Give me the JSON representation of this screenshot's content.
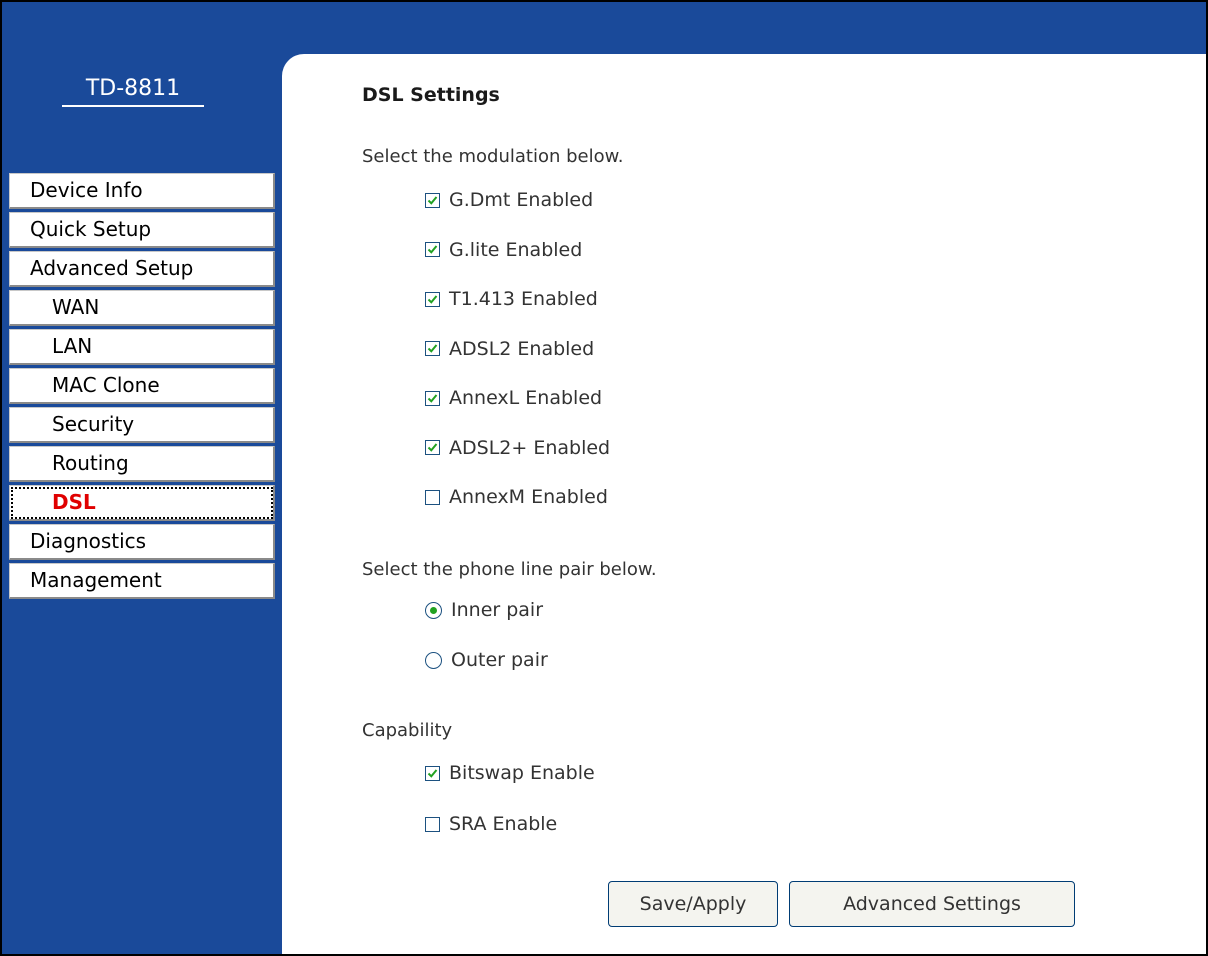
{
  "brand": {
    "model": "TD-8811"
  },
  "nav": [
    {
      "label": "Device Info",
      "level": 0,
      "active": false,
      "name": "nav-device-info"
    },
    {
      "label": "Quick Setup",
      "level": 0,
      "active": false,
      "name": "nav-quick-setup"
    },
    {
      "label": "Advanced Setup",
      "level": 0,
      "active": false,
      "name": "nav-advanced-setup"
    },
    {
      "label": "WAN",
      "level": 1,
      "active": false,
      "name": "nav-wan"
    },
    {
      "label": "LAN",
      "level": 1,
      "active": false,
      "name": "nav-lan"
    },
    {
      "label": "MAC Clone",
      "level": 1,
      "active": false,
      "name": "nav-mac-clone"
    },
    {
      "label": "Security",
      "level": 1,
      "active": false,
      "name": "nav-security"
    },
    {
      "label": "Routing",
      "level": 1,
      "active": false,
      "name": "nav-routing"
    },
    {
      "label": "DSL",
      "level": 1,
      "active": true,
      "name": "nav-dsl"
    },
    {
      "label": "Diagnostics",
      "level": 0,
      "active": false,
      "name": "nav-diagnostics"
    },
    {
      "label": "Management",
      "level": 0,
      "active": false,
      "name": "nav-management"
    }
  ],
  "page": {
    "title": "DSL Settings",
    "modulation_label": "Select the modulation below.",
    "modulation": [
      {
        "label": "G.Dmt Enabled",
        "checked": true
      },
      {
        "label": "G.lite Enabled",
        "checked": true
      },
      {
        "label": "T1.413 Enabled",
        "checked": true
      },
      {
        "label": "ADSL2 Enabled",
        "checked": true
      },
      {
        "label": "AnnexL Enabled",
        "checked": true
      },
      {
        "label": "ADSL2+ Enabled",
        "checked": true
      },
      {
        "label": "AnnexM Enabled",
        "checked": false
      }
    ],
    "phone_pair_label": "Select the phone line pair below.",
    "phone_pair": [
      {
        "label": "Inner pair",
        "selected": true
      },
      {
        "label": "Outer pair",
        "selected": false
      }
    ],
    "capability_label": "Capability",
    "capability": [
      {
        "label": "Bitswap Enable",
        "checked": true
      },
      {
        "label": "SRA Enable",
        "checked": false
      }
    ]
  },
  "buttons": {
    "save_apply": "Save/Apply",
    "advanced_settings": "Advanced Settings"
  },
  "colors": {
    "sidebar_bg": "#1a4a9a",
    "active_nav_text": "#e00000",
    "check_green": "#21a121"
  }
}
